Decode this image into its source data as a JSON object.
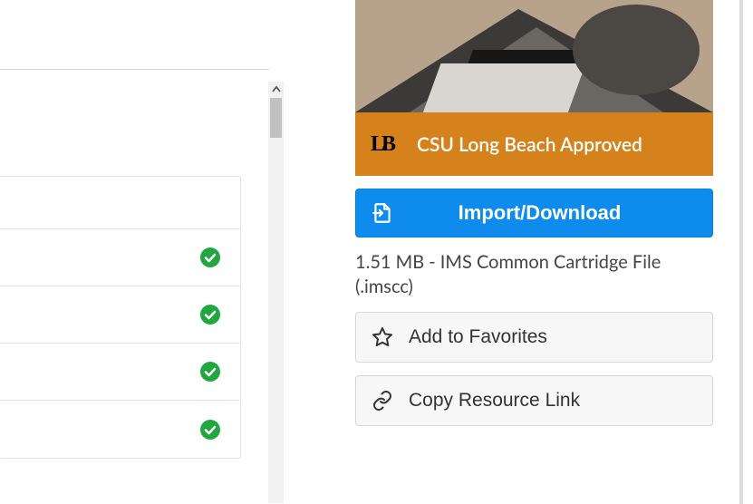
{
  "approval": {
    "label": "CSU Long Beach Approved",
    "logo_text": "LB"
  },
  "import": {
    "label": "Import/Download"
  },
  "file": {
    "meta": "1.51 MB - IMS Common Cartridge File (.imscc)"
  },
  "favorites": {
    "label": "Add to Favorites"
  },
  "copylink": {
    "label": "Copy Resource Link"
  },
  "list": {
    "rows": [
      {
        "complete": true
      },
      {
        "complete": true
      },
      {
        "complete": true
      },
      {
        "complete": true
      }
    ]
  }
}
